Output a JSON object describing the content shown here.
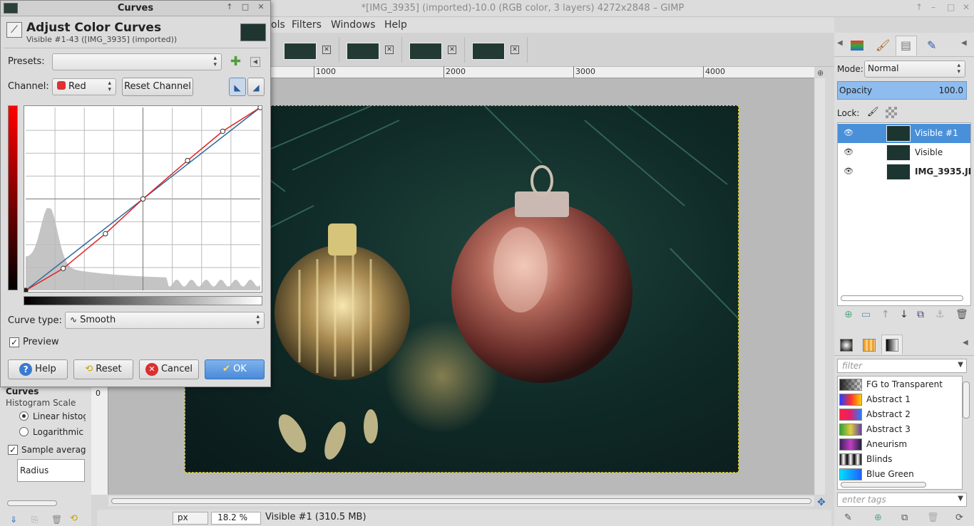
{
  "window": {
    "title": "*[IMG_3935] (imported)-10.0 (RGB color, 3 layers) 4272x2848 – GIMP"
  },
  "menu": [
    "ols",
    "Filters",
    "Windows",
    "Help"
  ],
  "ruler": {
    "marks": [
      "1000",
      "2000",
      "3000",
      "4000"
    ]
  },
  "left_ruler_mark": "0",
  "statusbar": {
    "unit": "px",
    "zoom": "18.2 %",
    "info": "Visible #1 (310.5 MB)"
  },
  "tool_options": {
    "title": "Curves",
    "histogram_scale_label": "Histogram Scale",
    "linear": "Linear histog",
    "logarithmic": "Logarithmic l",
    "sample_average": "Sample average",
    "radius_label": "Radius"
  },
  "right_dock": {
    "mode_label": "Mode:",
    "mode_value": "Normal",
    "opacity_label": "Opacity",
    "opacity_value": "100.0",
    "lock_label": "Lock:",
    "layers": [
      {
        "name": "Visible #1",
        "selected": true
      },
      {
        "name": "Visible",
        "selected": false
      },
      {
        "name": "IMG_3935.JPG",
        "selected": false
      }
    ],
    "filter_placeholder": "filter",
    "gradients": [
      {
        "name": "FG to Transparent"
      },
      {
        "name": "Abstract 1"
      },
      {
        "name": "Abstract 2"
      },
      {
        "name": "Abstract 3"
      },
      {
        "name": "Aneurism"
      },
      {
        "name": "Blinds"
      },
      {
        "name": "Blue Green"
      }
    ],
    "tags_placeholder": "enter tags"
  },
  "curves_dialog": {
    "title": "Curves",
    "heading": "Adjust Color Curves",
    "subheading": "Visible #1-43 ([IMG_3935] (imported))",
    "presets_label": "Presets:",
    "channel_label": "Channel:",
    "channel_value": "Red",
    "reset_channel": "Reset Channel",
    "curve_type_label": "Curve type:",
    "curve_type_value": "Smooth",
    "preview_label": "Preview",
    "buttons": {
      "help": "Help",
      "reset": "Reset",
      "cancel": "Cancel",
      "ok": "OK"
    },
    "curve_points": [
      [
        0,
        0
      ],
      [
        0.16,
        0.12
      ],
      [
        0.34,
        0.31
      ],
      [
        0.5,
        0.5
      ],
      [
        0.69,
        0.71
      ],
      [
        0.84,
        0.87
      ],
      [
        1,
        1
      ]
    ],
    "curve_color": "#e02020",
    "reference_color": "#2f6b9a"
  }
}
